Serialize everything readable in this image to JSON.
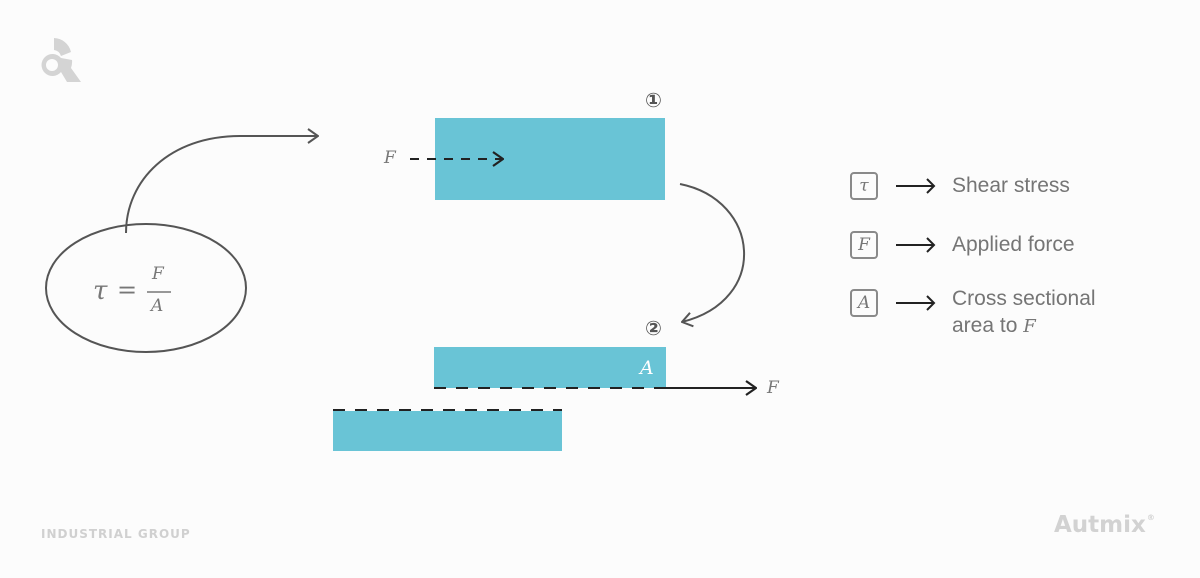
{
  "diagram": {
    "title": "Shear stress",
    "formula": {
      "lhs": "τ",
      "operator": "=",
      "numerator": "F",
      "denominator": "A"
    },
    "step_one": {
      "marker": "①",
      "force_label": "F"
    },
    "step_two": {
      "marker": "②",
      "area_label": "A",
      "force_label": "F"
    },
    "legend": [
      {
        "symbol": "τ",
        "text": "Shear stress",
        "text_suffix": ""
      },
      {
        "symbol": "F",
        "text": "Applied force",
        "text_suffix": ""
      },
      {
        "symbol": "A",
        "text_line1": "Cross sectional",
        "text_line2": "area to",
        "text_suffix": "F"
      }
    ],
    "colors": {
      "block": "#69c4d6",
      "line": "#555555",
      "text": "#777777"
    }
  },
  "branding": {
    "left_label": "INDUSTRIAL GROUP",
    "right_label": "Autmix",
    "right_mark": "®"
  }
}
